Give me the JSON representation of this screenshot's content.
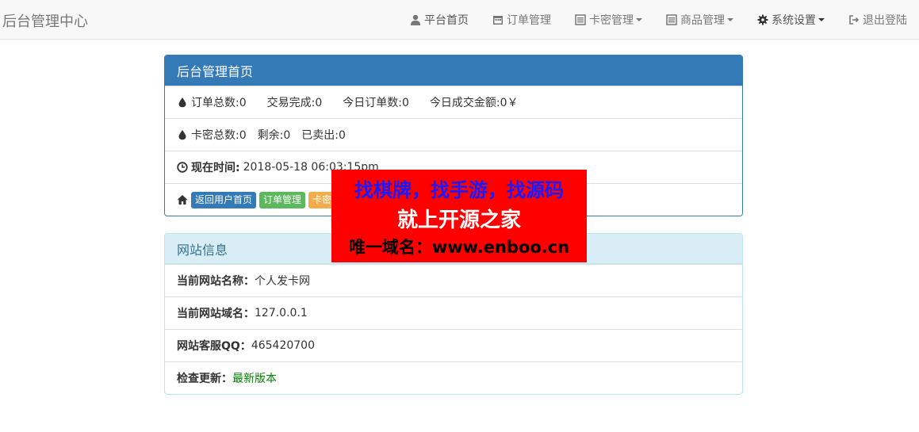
{
  "navbar": {
    "brand": "后台管理中心",
    "items": [
      {
        "label": "平台首页",
        "icon": "user-icon",
        "dropdown": false
      },
      {
        "label": "订单管理",
        "icon": "calendar-icon",
        "dropdown": false
      },
      {
        "label": "卡密管理",
        "icon": "list-icon",
        "dropdown": true
      },
      {
        "label": "商品管理",
        "icon": "list-icon",
        "dropdown": true
      },
      {
        "label": "系统设置",
        "icon": "gear-icon",
        "dropdown": true
      },
      {
        "label": "退出登陆",
        "icon": "logout-icon",
        "dropdown": false
      }
    ]
  },
  "main_panel": {
    "title": "后台管理首页",
    "orders": {
      "total": "订单总数:0",
      "completed": "交易完成:0",
      "today": "今日订单数:0",
      "today_amount": "今日成交金额:0￥"
    },
    "cards": {
      "total": "卡密总数:0",
      "remaining": "剩余:0",
      "sold": "已卖出:0"
    },
    "time": {
      "label": "现在时间:",
      "value": "2018-05-18 06:03:15pm"
    },
    "buttons": {
      "home": "返回用户首页",
      "orders": "订单管理",
      "cards": "卡密"
    }
  },
  "site_panel": {
    "title": "网站信息",
    "rows": [
      {
        "label": "当前网站名称：",
        "value": "个人发卡网"
      },
      {
        "label": "当前网站域名：",
        "value": "127.0.0.1"
      },
      {
        "label": "网站客服QQ：",
        "value": "465420700"
      },
      {
        "label": "检查更新：",
        "value": "最新版本"
      }
    ]
  },
  "watermark": {
    "line1": "找棋牌，找手游，找源码",
    "line2": "就上开源之家",
    "line3": "唯一域名：www.enboo.cn"
  },
  "colors": {
    "primary": "#337ab7",
    "info_bg": "#d9edf7",
    "success": "#5cb85c",
    "warning": "#f0ad4e",
    "watermark_bg": "#ff0000"
  }
}
